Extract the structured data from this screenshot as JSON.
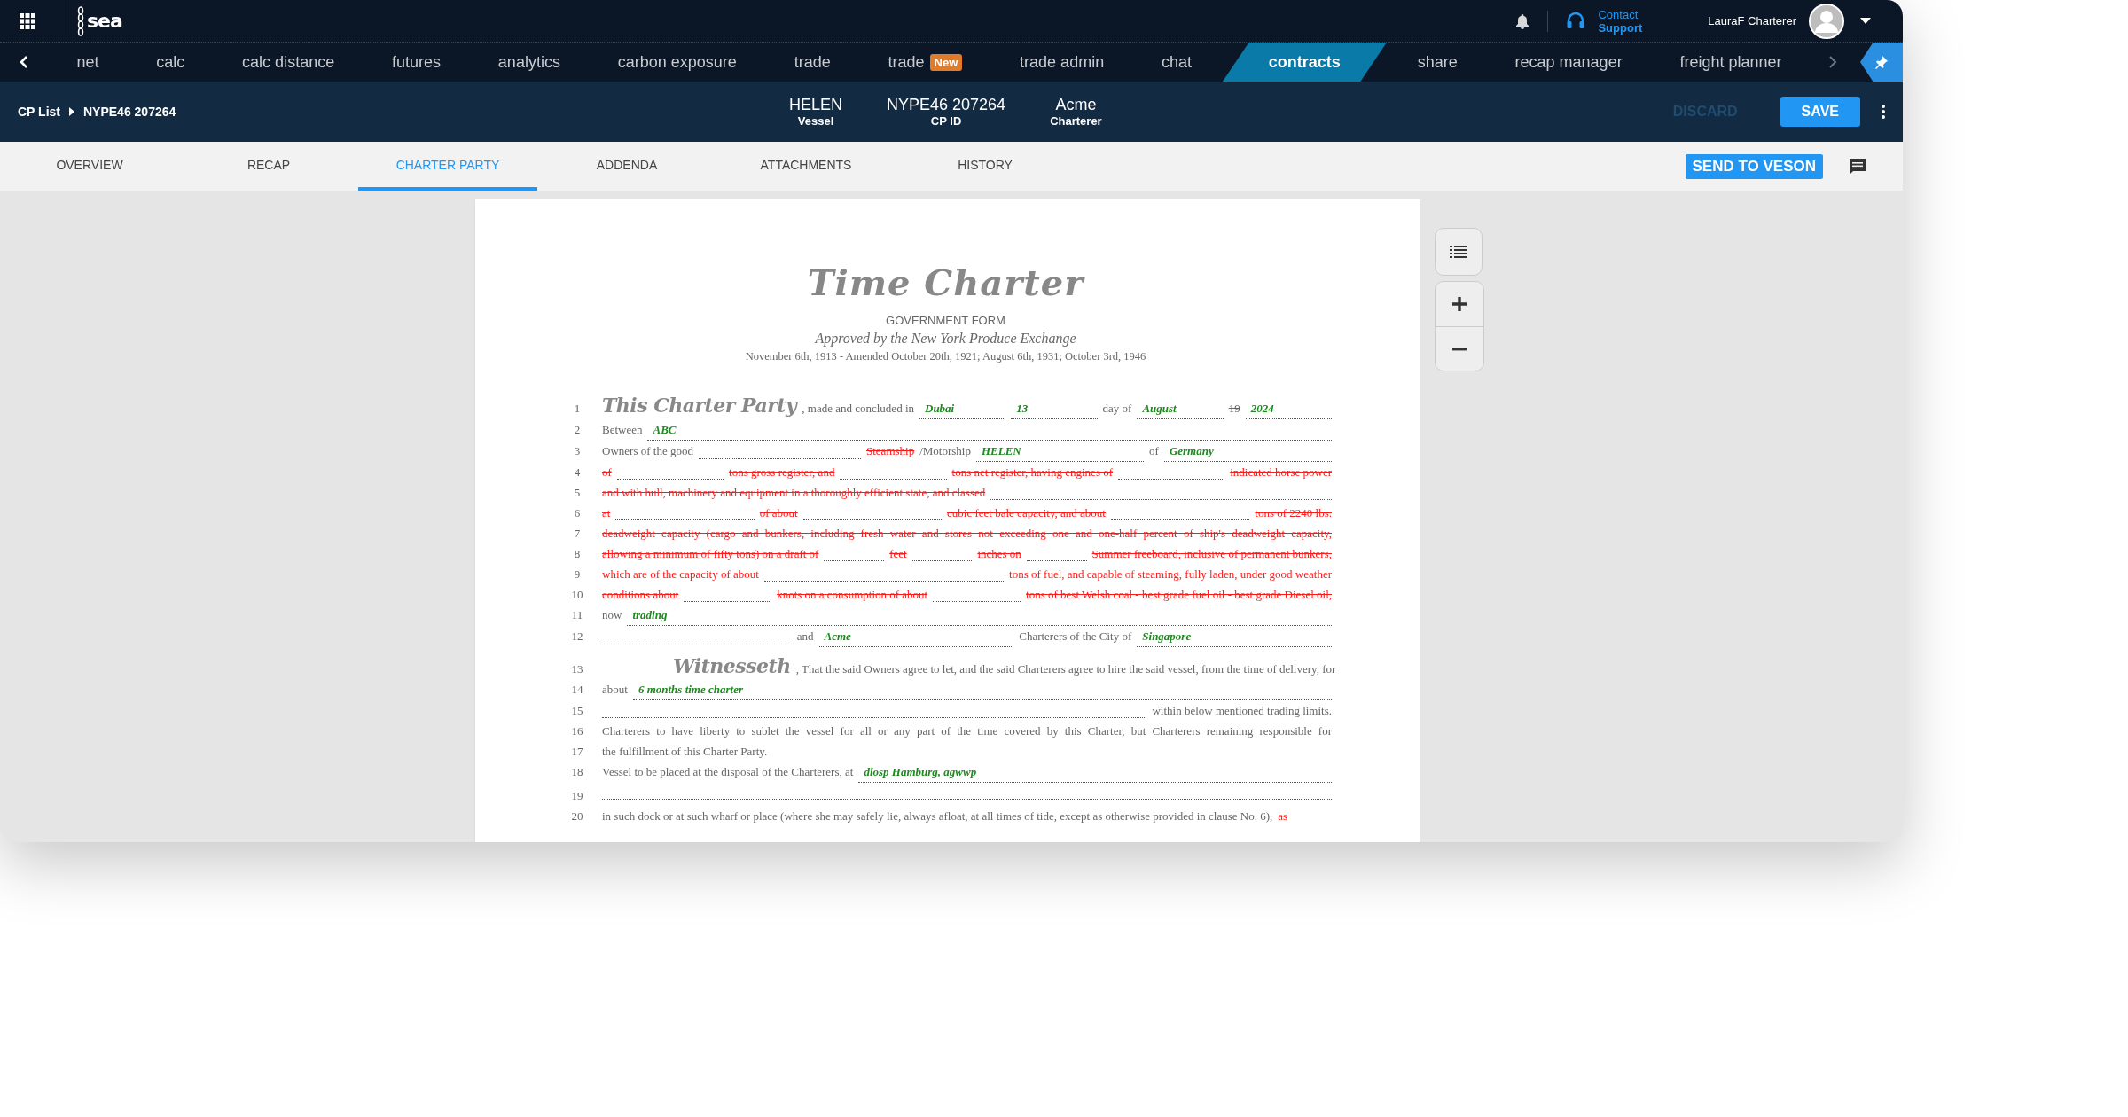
{
  "top_bar": {
    "logo": "sea",
    "contact": {
      "line_1": "Contact",
      "line_2": "Support"
    },
    "user": "LauraF Charterer"
  },
  "nav": {
    "items": [
      {
        "label": "net",
        "selected": false
      },
      {
        "label": "calc",
        "selected": false
      },
      {
        "label": "calc distance",
        "selected": false
      },
      {
        "label": "futures",
        "selected": false
      },
      {
        "label": "analytics",
        "selected": false
      },
      {
        "label": "carbon exposure",
        "selected": false
      },
      {
        "label": "trade",
        "selected": false
      },
      {
        "label": "trade",
        "selected": false,
        "badge": "New"
      },
      {
        "label": "trade admin",
        "selected": false
      },
      {
        "label": "chat",
        "selected": false
      },
      {
        "label": "contracts",
        "selected": true
      },
      {
        "label": "share",
        "selected": false
      },
      {
        "label": "recap manager",
        "selected": false
      },
      {
        "label": "freight planner",
        "selected": false
      }
    ]
  },
  "contract_header": {
    "breadcrumb": [
      "CP List",
      "NYPE46 207264"
    ],
    "info": [
      {
        "value": "HELEN",
        "label": "Vessel"
      },
      {
        "value": "NYPE46 207264",
        "label": "CP ID"
      },
      {
        "value": "Acme",
        "label": "Charterer"
      }
    ],
    "buttons": [
      {
        "label": "DISCARD",
        "kind": "secondary",
        "disabled": true
      },
      {
        "label": "SAVE",
        "kind": "primary",
        "disabled": false
      }
    ]
  },
  "tabs": [
    {
      "label": "OVERVIEW",
      "selected": false
    },
    {
      "label": "RECAP",
      "selected": false
    },
    {
      "label": "CHARTER PARTY",
      "selected": true
    },
    {
      "label": "ADDENDA",
      "selected": false
    },
    {
      "label": "ATTACHMENTS",
      "selected": false
    },
    {
      "label": "HISTORY",
      "selected": false
    }
  ],
  "send_button": "SEND TO VESON",
  "document": {
    "title": "Time Charter",
    "subtitle": "GOVERNMENT FORM",
    "approved": "Approved by the New York Produce Exchange",
    "dates": "November 6th, 1913 - Amended October 20th, 1921; August 6th, 1931; October 3rd, 1946",
    "lines": [
      {
        "number": "1",
        "segments": [
          {
            "kind": "gothic",
            "text": "This Charter Party"
          },
          {
            "kind": "text",
            "text": ", made and concluded in"
          },
          {
            "kind": "value",
            "text": "Dubai"
          },
          {
            "kind": "value",
            "text": "13"
          },
          {
            "kind": "text",
            "text": "day of"
          },
          {
            "kind": "value",
            "text": "August"
          },
          {
            "kind": "oldstruck",
            "text": "19"
          },
          {
            "kind": "value",
            "text": "2024"
          }
        ]
      },
      {
        "number": "2",
        "segments": [
          {
            "kind": "text",
            "text": "Between"
          },
          {
            "kind": "value",
            "text": "ABC"
          }
        ]
      },
      {
        "number": "3",
        "segments": [
          {
            "kind": "text",
            "text": "Owners of the good"
          },
          {
            "kind": "blank"
          },
          {
            "kind": "struck",
            "text": "Steamship"
          },
          {
            "kind": "text",
            "text": "/Motorship"
          },
          {
            "kind": "value",
            "text": "HELEN"
          },
          {
            "kind": "text",
            "text": "of"
          },
          {
            "kind": "value",
            "text": "Germany"
          }
        ]
      },
      {
        "number": "4",
        "segments": [
          {
            "kind": "struck",
            "text": "of"
          },
          {
            "kind": "blank"
          },
          {
            "kind": "struck",
            "text": "tons gross register, and"
          },
          {
            "kind": "blank"
          },
          {
            "kind": "struck",
            "text": "tons net register, having engines of"
          },
          {
            "kind": "blank"
          },
          {
            "kind": "struck",
            "text": "indicated horse power"
          }
        ]
      },
      {
        "number": "5",
        "segments": [
          {
            "kind": "struck",
            "text": "and with hull, machinery and equipment in a thoroughly efficient state, and classed"
          },
          {
            "kind": "blank"
          }
        ]
      },
      {
        "number": "6",
        "segments": [
          {
            "kind": "struck",
            "text": "at"
          },
          {
            "kind": "blank"
          },
          {
            "kind": "struck",
            "text": "of about"
          },
          {
            "kind": "blank"
          },
          {
            "kind": "struck",
            "text": "cubic feet bale capacity, and about"
          },
          {
            "kind": "blank"
          },
          {
            "kind": "struck",
            "text": "tons of 2240 lbs."
          }
        ]
      },
      {
        "number": "7",
        "justified": true,
        "segments": [
          {
            "kind": "struck",
            "text": "deadweight capacity (cargo and bunkers, including fresh water and stores not exceeding one and one-half percent of ship's deadweight capacity,"
          }
        ]
      },
      {
        "number": "8",
        "segments": [
          {
            "kind": "struck",
            "text": "allowing a minimum of fifty tons) on a draft of"
          },
          {
            "kind": "blank"
          },
          {
            "kind": "struck",
            "text": "feet"
          },
          {
            "kind": "blank"
          },
          {
            "kind": "struck",
            "text": "inches on"
          },
          {
            "kind": "blank"
          },
          {
            "kind": "struck",
            "text": "Summer freeboard, inclusive of permanent bunkers,"
          }
        ]
      },
      {
        "number": "9",
        "segments": [
          {
            "kind": "struck",
            "text": "which are of the capacity of about"
          },
          {
            "kind": "blank"
          },
          {
            "kind": "struck",
            "text": "tons of fuel, and capable of steaming, fully laden, under good weather"
          }
        ]
      },
      {
        "number": "10",
        "segments": [
          {
            "kind": "struck",
            "text": "conditions about"
          },
          {
            "kind": "blank"
          },
          {
            "kind": "struck",
            "text": "knots on a consumption of about"
          },
          {
            "kind": "blank"
          },
          {
            "kind": "struck",
            "text": "tons of best Welsh coal - best grade fuel oil - best grade Diesel oil,"
          }
        ]
      },
      {
        "number": "11",
        "segments": [
          {
            "kind": "text",
            "text": "now"
          },
          {
            "kind": "value",
            "text": "trading"
          }
        ]
      },
      {
        "number": "12",
        "segments": [
          {
            "kind": "blank"
          },
          {
            "kind": "text",
            "text": "and"
          },
          {
            "kind": "value",
            "text": "Acme"
          },
          {
            "kind": "text",
            "text": "Charterers of the City of"
          },
          {
            "kind": "value",
            "text": "Singapore"
          }
        ]
      },
      {
        "number": "13",
        "indented": true,
        "segments": [
          {
            "kind": "gothic",
            "text": "Witnesseth"
          },
          {
            "kind": "text",
            "text": ", That the said Owners agree to let, and the said Charterers agree to hire the said vessel, from the time of delivery, for"
          }
        ]
      },
      {
        "number": "14",
        "segments": [
          {
            "kind": "text",
            "text": "about"
          },
          {
            "kind": "value",
            "text": "6 months time charter"
          }
        ]
      },
      {
        "number": "15",
        "segments": [
          {
            "kind": "blank"
          },
          {
            "kind": "text",
            "text": "within below mentioned trading limits."
          }
        ]
      },
      {
        "number": "16",
        "justified": true,
        "segments": [
          {
            "kind": "text",
            "text": "Charterers to have liberty to sublet the vessel for all or any part of the time covered by this Charter, but Charterers remaining responsible for"
          }
        ]
      },
      {
        "number": "17",
        "segments": [
          {
            "kind": "text",
            "text": "the fulfillment of this Charter Party."
          }
        ]
      },
      {
        "number": "18",
        "segments": [
          {
            "kind": "text",
            "text": "Vessel to be placed at the disposal of the Charterers, at"
          },
          {
            "kind": "value",
            "text": "dlosp Hamburg, agwwp"
          }
        ]
      },
      {
        "number": "19",
        "segments": [
          {
            "kind": "blank"
          }
        ]
      },
      {
        "number": "20",
        "segments": [
          {
            "kind": "text",
            "text": "in such dock or at such wharf or place (where she may safely lie, always afloat, at all times of tide, except as otherwise provided in clause No. 6),"
          },
          {
            "kind": "struck",
            "text": "as"
          }
        ]
      }
    ]
  }
}
